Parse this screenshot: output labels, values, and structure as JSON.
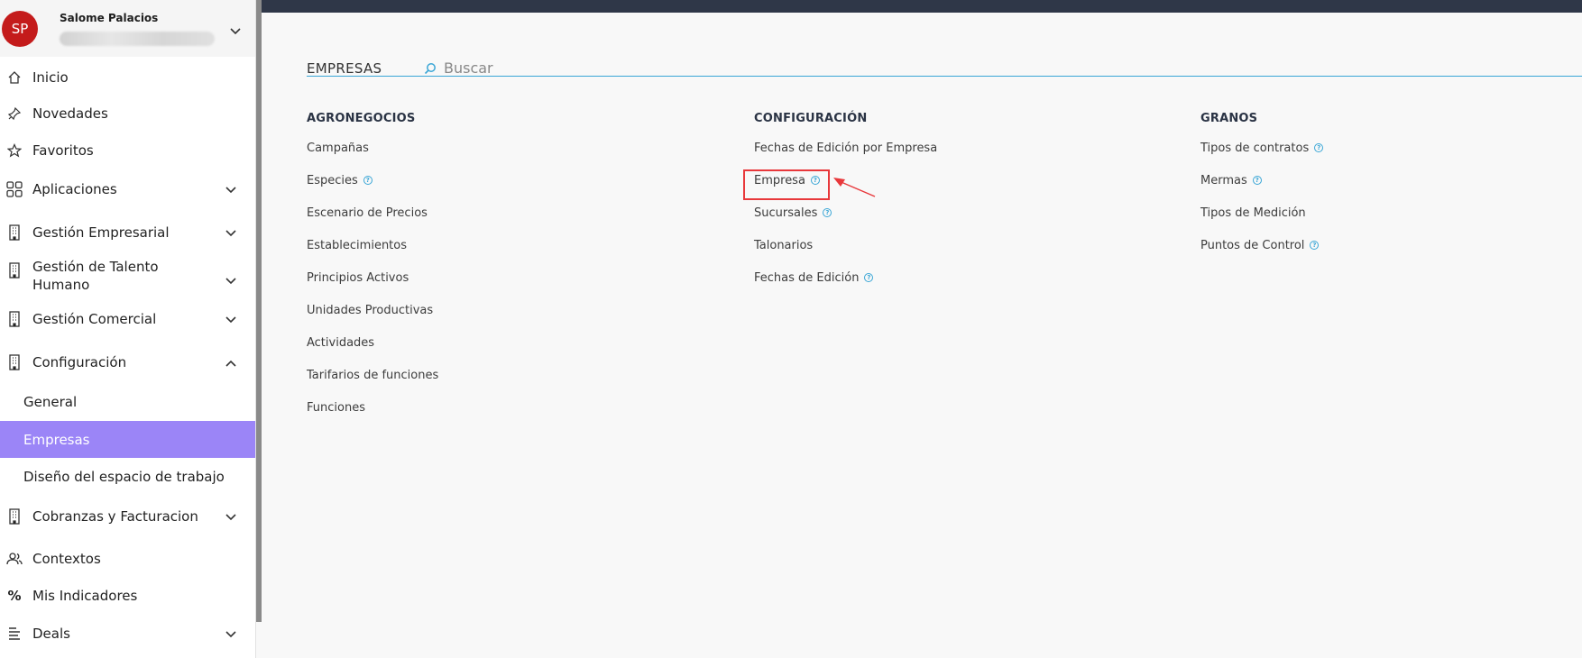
{
  "user": {
    "initials": "SP",
    "name": "Salome Palacios"
  },
  "sidebar": {
    "items": [
      {
        "label": "Inicio",
        "icon": "home-icon"
      },
      {
        "label": "Novedades",
        "icon": "pin-icon"
      },
      {
        "label": "Favoritos",
        "icon": "star-icon"
      },
      {
        "label": "Aplicaciones",
        "icon": "grid-icon"
      },
      {
        "label": "Gestión Empresarial",
        "icon": "building-icon"
      },
      {
        "label": "Gestión de Talento Humano",
        "icon": "building-icon"
      },
      {
        "label": "Gestión Comercial",
        "icon": "building-icon"
      },
      {
        "label": "Configuración",
        "icon": "building-icon"
      },
      {
        "label": "General"
      },
      {
        "label": "Empresas"
      },
      {
        "label": "Diseño del espacio de trabajo"
      },
      {
        "label": "Cobranzas y Facturacion",
        "icon": "building-icon"
      },
      {
        "label": "Contextos",
        "icon": "users-icon"
      },
      {
        "label": "Mis Indicadores",
        "icon": "percent-icon"
      },
      {
        "label": "Deals",
        "icon": "deals-icon"
      }
    ]
  },
  "header": {
    "title": "EMPRESAS",
    "search_placeholder": "Buscar"
  },
  "columns": [
    {
      "heading": "AGRONEGOCIOS",
      "links": [
        "Campañas",
        "Especies",
        "Escenario de Precios",
        "Establecimientos",
        "Principios Activos",
        "Unidades Productivas",
        "Actividades",
        "Tarifarios de funciones",
        "Funciones"
      ]
    },
    {
      "heading": "CONFIGURACIÓN",
      "links": [
        "Fechas de Edición por Empresa",
        "Empresa",
        "Sucursales",
        "Talonarios",
        "Fechas de Edición"
      ]
    },
    {
      "heading": "GRANOS",
      "links": [
        "Tipos de contratos",
        "Mermas",
        "Tipos de Medición",
        "Puntos de Control"
      ]
    }
  ],
  "colors": {
    "accent": "#9b85f7",
    "topbar": "#2f3748",
    "link_accent": "#3aa6d6",
    "highlight": "#e8383b"
  }
}
